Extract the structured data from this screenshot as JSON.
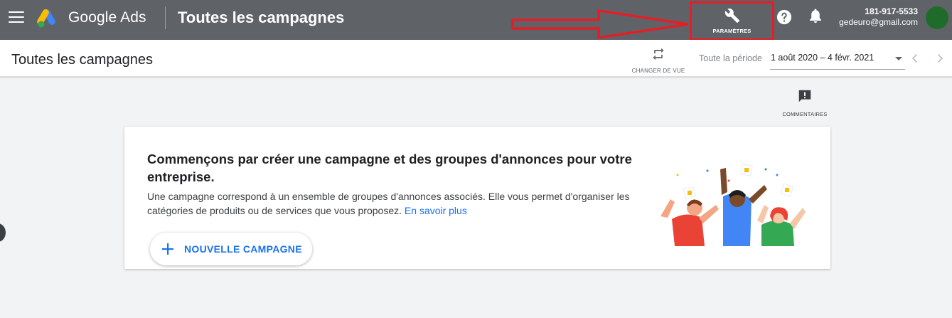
{
  "topbar": {
    "brand": "Google Ads",
    "title": "Toutes les campagnes",
    "settings_label": "PARAMÈTRES",
    "account_id": "181-917-5533",
    "account_email": "gedeuro@gmail.com"
  },
  "subbar": {
    "title": "Toutes les campagnes",
    "change_view_label": "CHANGER DE VUE",
    "period_label": "Toute la période",
    "date_range": "1 août 2020 – 4 févr. 2021"
  },
  "feedback": {
    "label": "COMMENTAIRES"
  },
  "card": {
    "title": "Commençons par créer une campagne et des groupes d'annonces pour votre entreprise.",
    "description": "Une campagne correspond à un ensemble de groupes d'annonces associés. Elle vous permet d'organiser les catégories de produits ou de services que vous proposez. ",
    "learn_more": "En savoir plus",
    "button_label": "NOUVELLE CAMPAGNE"
  },
  "icons": {
    "menu": "hamburger-menu-icon",
    "logo": "google-ads-logo",
    "settings": "wrench-icon",
    "help": "help-circle-icon",
    "notifications": "bell-icon",
    "change_view": "swap-arrows-icon",
    "feedback": "feedback-chat-icon",
    "add": "plus-icon",
    "prev": "chevron-left-icon",
    "next": "chevron-right-icon",
    "annotation": "red-arrow-annotation"
  },
  "colors": {
    "topbar_bg": "#5f6368",
    "accent_blue": "#1a73e8",
    "annotation_red": "#e41e26",
    "page_bg": "#f1f3f4"
  }
}
